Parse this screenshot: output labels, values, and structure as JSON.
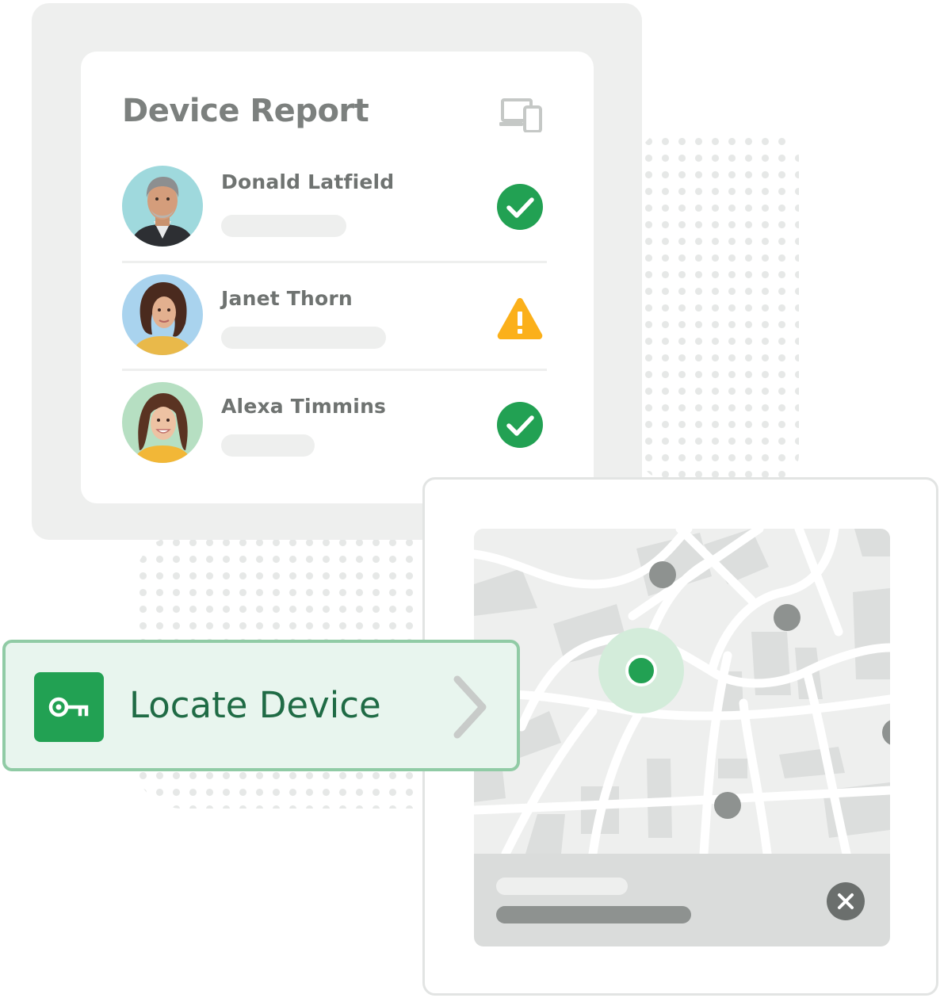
{
  "device_report": {
    "title": "Device Report",
    "header_icon": "devices-icon",
    "people": [
      {
        "name": "Donald Latfield",
        "status": "success",
        "status_icon": "check-circle-icon"
      },
      {
        "name": "Janet Thorn",
        "status": "warning",
        "status_icon": "warning-triangle-icon"
      },
      {
        "name": "Alexa Timmins",
        "status": "success",
        "status_icon": "check-circle-icon"
      }
    ]
  },
  "locate_device": {
    "label": "Locate Device",
    "icon": "key-icon",
    "arrow_icon": "chevron-right-icon"
  },
  "map": {
    "close_icon": "close-icon"
  },
  "colors": {
    "success": "#22a153",
    "warning": "#fbb01a",
    "accent_text": "#1f6b45",
    "banner_bg": "#e8f5ee",
    "banner_border": "#90cba5",
    "location_halo": "#d3ecda"
  }
}
